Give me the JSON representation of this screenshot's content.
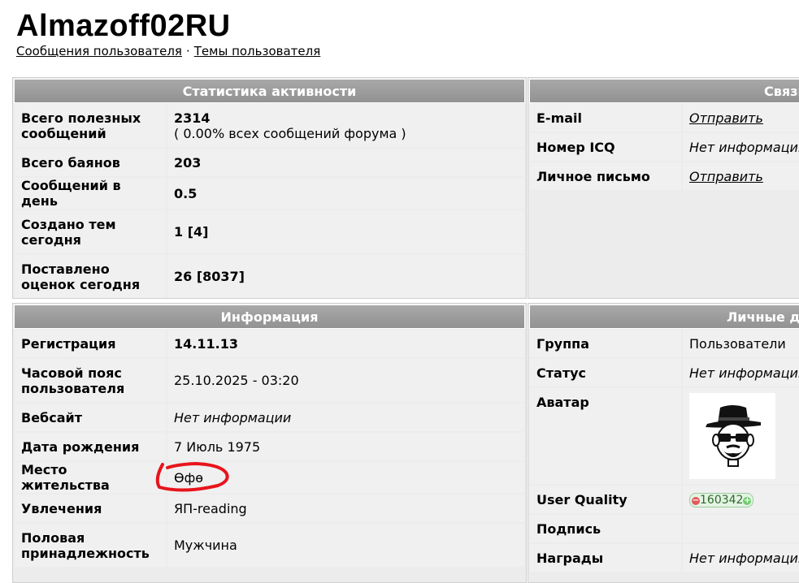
{
  "header": {
    "username": "Almazoff02RU",
    "nav": [
      {
        "label": "Сообщения пользователя"
      },
      {
        "label": "Темы пользователя"
      }
    ],
    "separator": "·"
  },
  "activity": {
    "title": "Статистика активности",
    "rows": [
      {
        "label": "Всего полезных сообщений",
        "value": "2314",
        "sub": "( 0.00% всех сообщений форума )"
      },
      {
        "label": "Всего баянов",
        "value": "203"
      },
      {
        "label": "Сообщений в день",
        "value": "0.5"
      },
      {
        "label": "Создано тем сегодня",
        "value": "1 [4]"
      },
      {
        "label": "Поставлено оценок сегодня",
        "value": "26 [8037]"
      }
    ]
  },
  "contacts": {
    "title": "Связь",
    "rows": [
      {
        "label": "E-mail",
        "value": "Отправить"
      },
      {
        "label": "Номер ICQ",
        "value": "Нет информации"
      },
      {
        "label": "Личное письмо",
        "value": "Отправить"
      }
    ]
  },
  "info": {
    "title": "Информация",
    "rows": [
      {
        "label": "Регистрация",
        "value": "14.11.13"
      },
      {
        "label": "Часовой пояс пользователя",
        "value": "25.10.2025 - 03:20"
      },
      {
        "label": "Вебсайт",
        "value": "Нет информации"
      },
      {
        "label": "Дата рождения",
        "value": "7 Июль 1975"
      },
      {
        "label": "Место жительства",
        "value": "Өфө"
      },
      {
        "label": "Увлечения",
        "value": "ЯП-reading"
      },
      {
        "label": "Половая принадлежность",
        "value": "Мужчина"
      }
    ]
  },
  "personal": {
    "title": "Личные данные",
    "rows": [
      {
        "label": "Группа",
        "value": "Пользователи"
      },
      {
        "label": "Статус",
        "value": "Нет информации"
      },
      {
        "label": "Аватар"
      },
      {
        "label": "User Quality",
        "value": "160342",
        "minus": "−",
        "plus": "+"
      },
      {
        "label": "Подпись",
        "value": ""
      },
      {
        "label": "Награды",
        "value": "Нет информации"
      }
    ]
  },
  "colors": {
    "header_bg": "#9e9e9e",
    "row_bg": "#f0f0f0",
    "annotation": "#e8141c"
  },
  "icons": {
    "avatar": "heisenberg-avatar",
    "annotation": "red-hand-drawn-circle"
  }
}
